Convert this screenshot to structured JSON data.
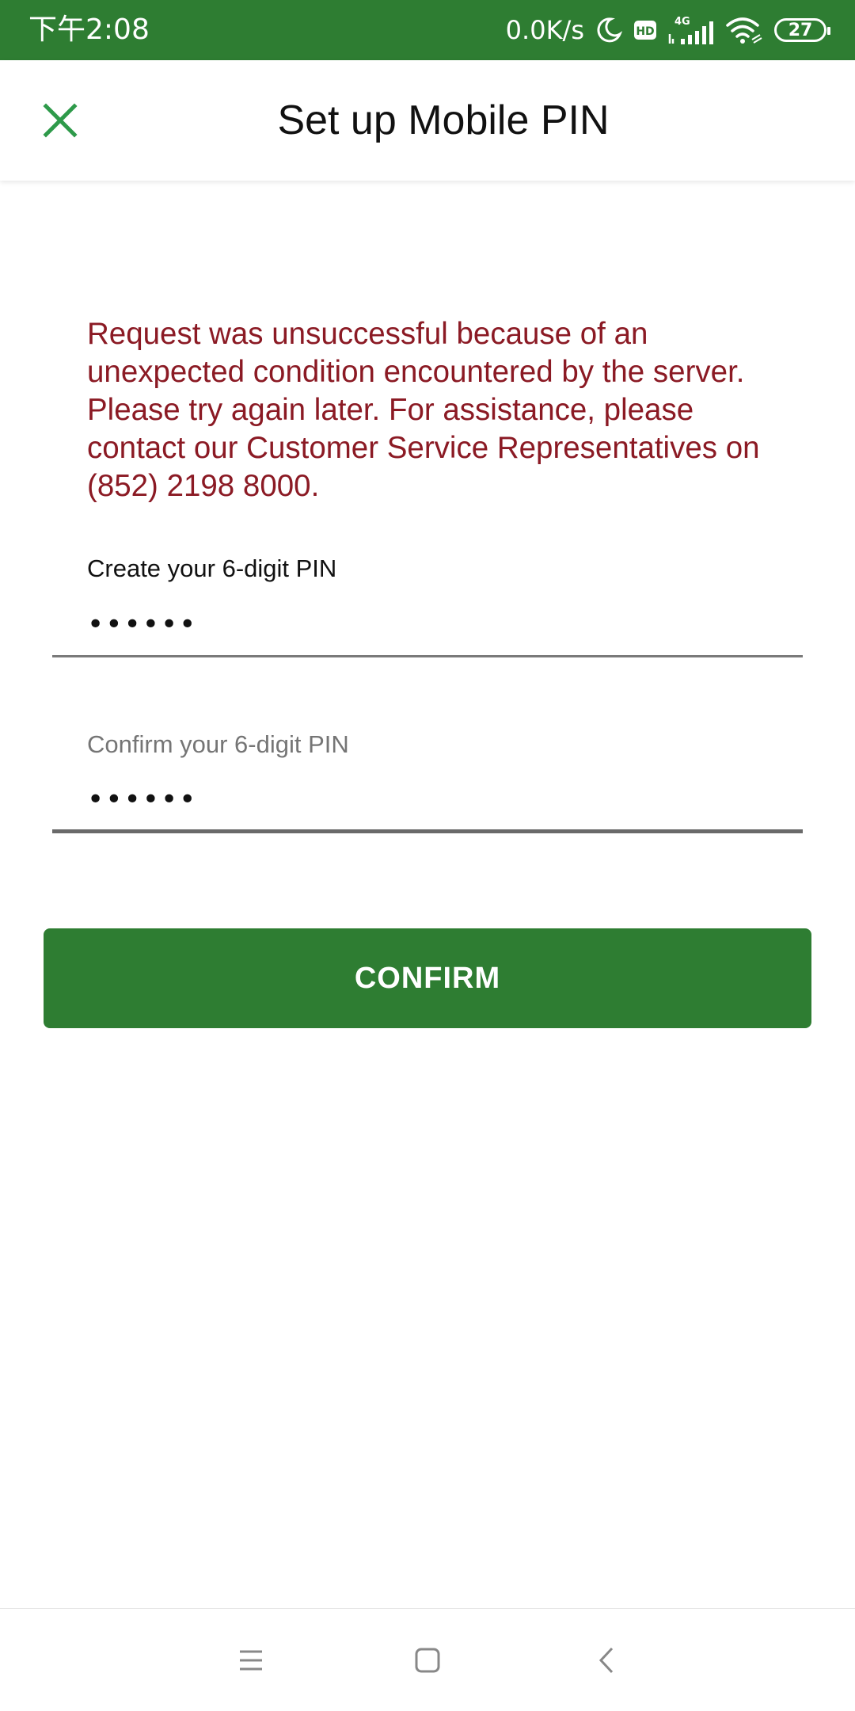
{
  "status_bar": {
    "time": "下午2:08",
    "network_speed": "0.0K/s",
    "network_type": "4G",
    "hd_label": "HD",
    "battery_level": "27",
    "icons": [
      "moon-icon",
      "hd-icon",
      "signal-icon",
      "wifi-icon",
      "battery-icon"
    ]
  },
  "header": {
    "title": "Set up Mobile PIN",
    "close_icon": "close-icon"
  },
  "error": {
    "message": "Request was unsuccessful because of an unexpected condition encountered by the server. Please try again later. For assistance, please contact our Customer Service Representatives on (852) 2198 8000."
  },
  "form": {
    "create_pin": {
      "label": "Create your 6-digit PIN",
      "value": "••••••"
    },
    "confirm_pin": {
      "label": "Confirm your 6-digit PIN",
      "value": "••••••"
    },
    "confirm_button": "CONFIRM"
  },
  "nav_bar": {
    "icons": [
      "menu-icon",
      "home-icon",
      "back-icon"
    ]
  },
  "colors": {
    "brand_green": "#2e7d32",
    "close_icon_green": "#2e9a4a",
    "error_red": "#8b1a24"
  }
}
